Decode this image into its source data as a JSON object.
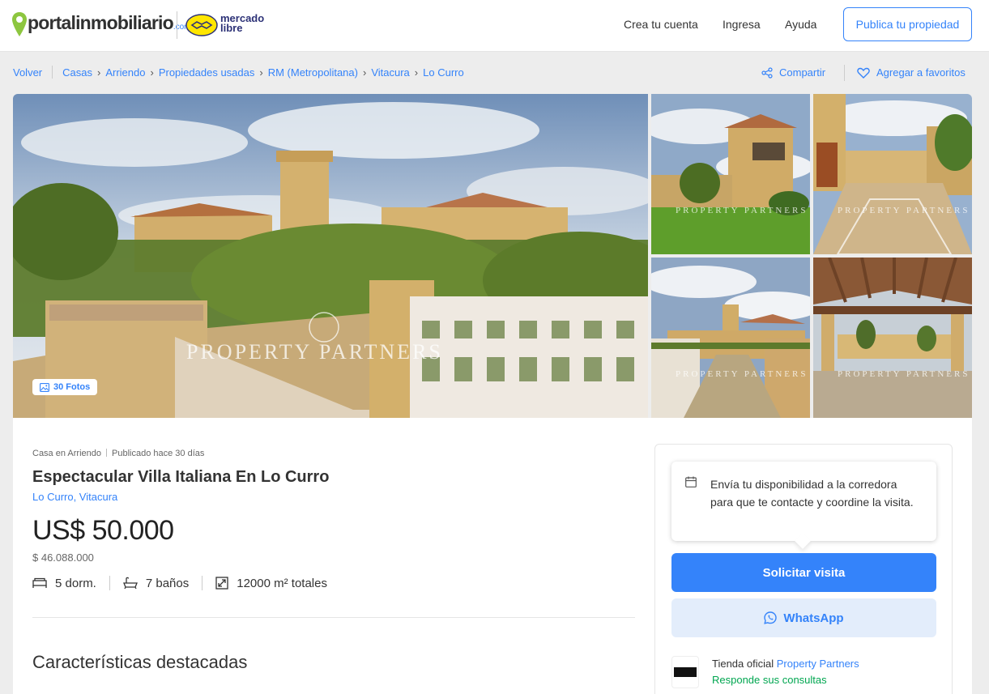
{
  "header": {
    "logo_text_a": "portal",
    "logo_text_b": "inmobiliario",
    "logo_com": ".com",
    "partner_logo_line1": "mercado",
    "partner_logo_line2": "libre",
    "nav": [
      "Crea tu cuenta",
      "Ingresa",
      "Ayuda"
    ],
    "publish_label": "Publica tu propiedad"
  },
  "breadcrumb": {
    "back": "Volver",
    "items": [
      "Casas",
      "Arriendo",
      "Propiedades usadas",
      "RM (Metropolitana)",
      "Vitacura",
      "Lo Curro"
    ]
  },
  "actions": {
    "share": "Compartir",
    "favorite": "Agregar a favoritos"
  },
  "gallery": {
    "photos_count": "30 Fotos",
    "watermark": "PROPERTY PARTNERS"
  },
  "listing": {
    "kind": "Casa en Arriendo",
    "published": "Publicado hace 30 días",
    "title": "Espectacular Villa Italiana En Lo Curro",
    "location": "Lo Curro, Vitacura",
    "price": "US$ 50.000",
    "price_clp": "$ 46.088.000",
    "bedrooms": "5 dorm.",
    "bathrooms": "7 baños",
    "area": "12000 m² totales",
    "features_heading": "Características destacadas"
  },
  "contact": {
    "tip": "Envía tu disponibilidad a la corredora para que te contacte y coordine la visita.",
    "visit_button": "Solicitar visita",
    "whatsapp_button": "WhatsApp",
    "store_prefix": "Tienda oficial",
    "store_name": "Property Partners",
    "store_reply": "Responde sus consultas"
  },
  "colors": {
    "accent": "#3483fa",
    "success": "#00a650",
    "whatsapp_bg": "#e3edfb"
  }
}
